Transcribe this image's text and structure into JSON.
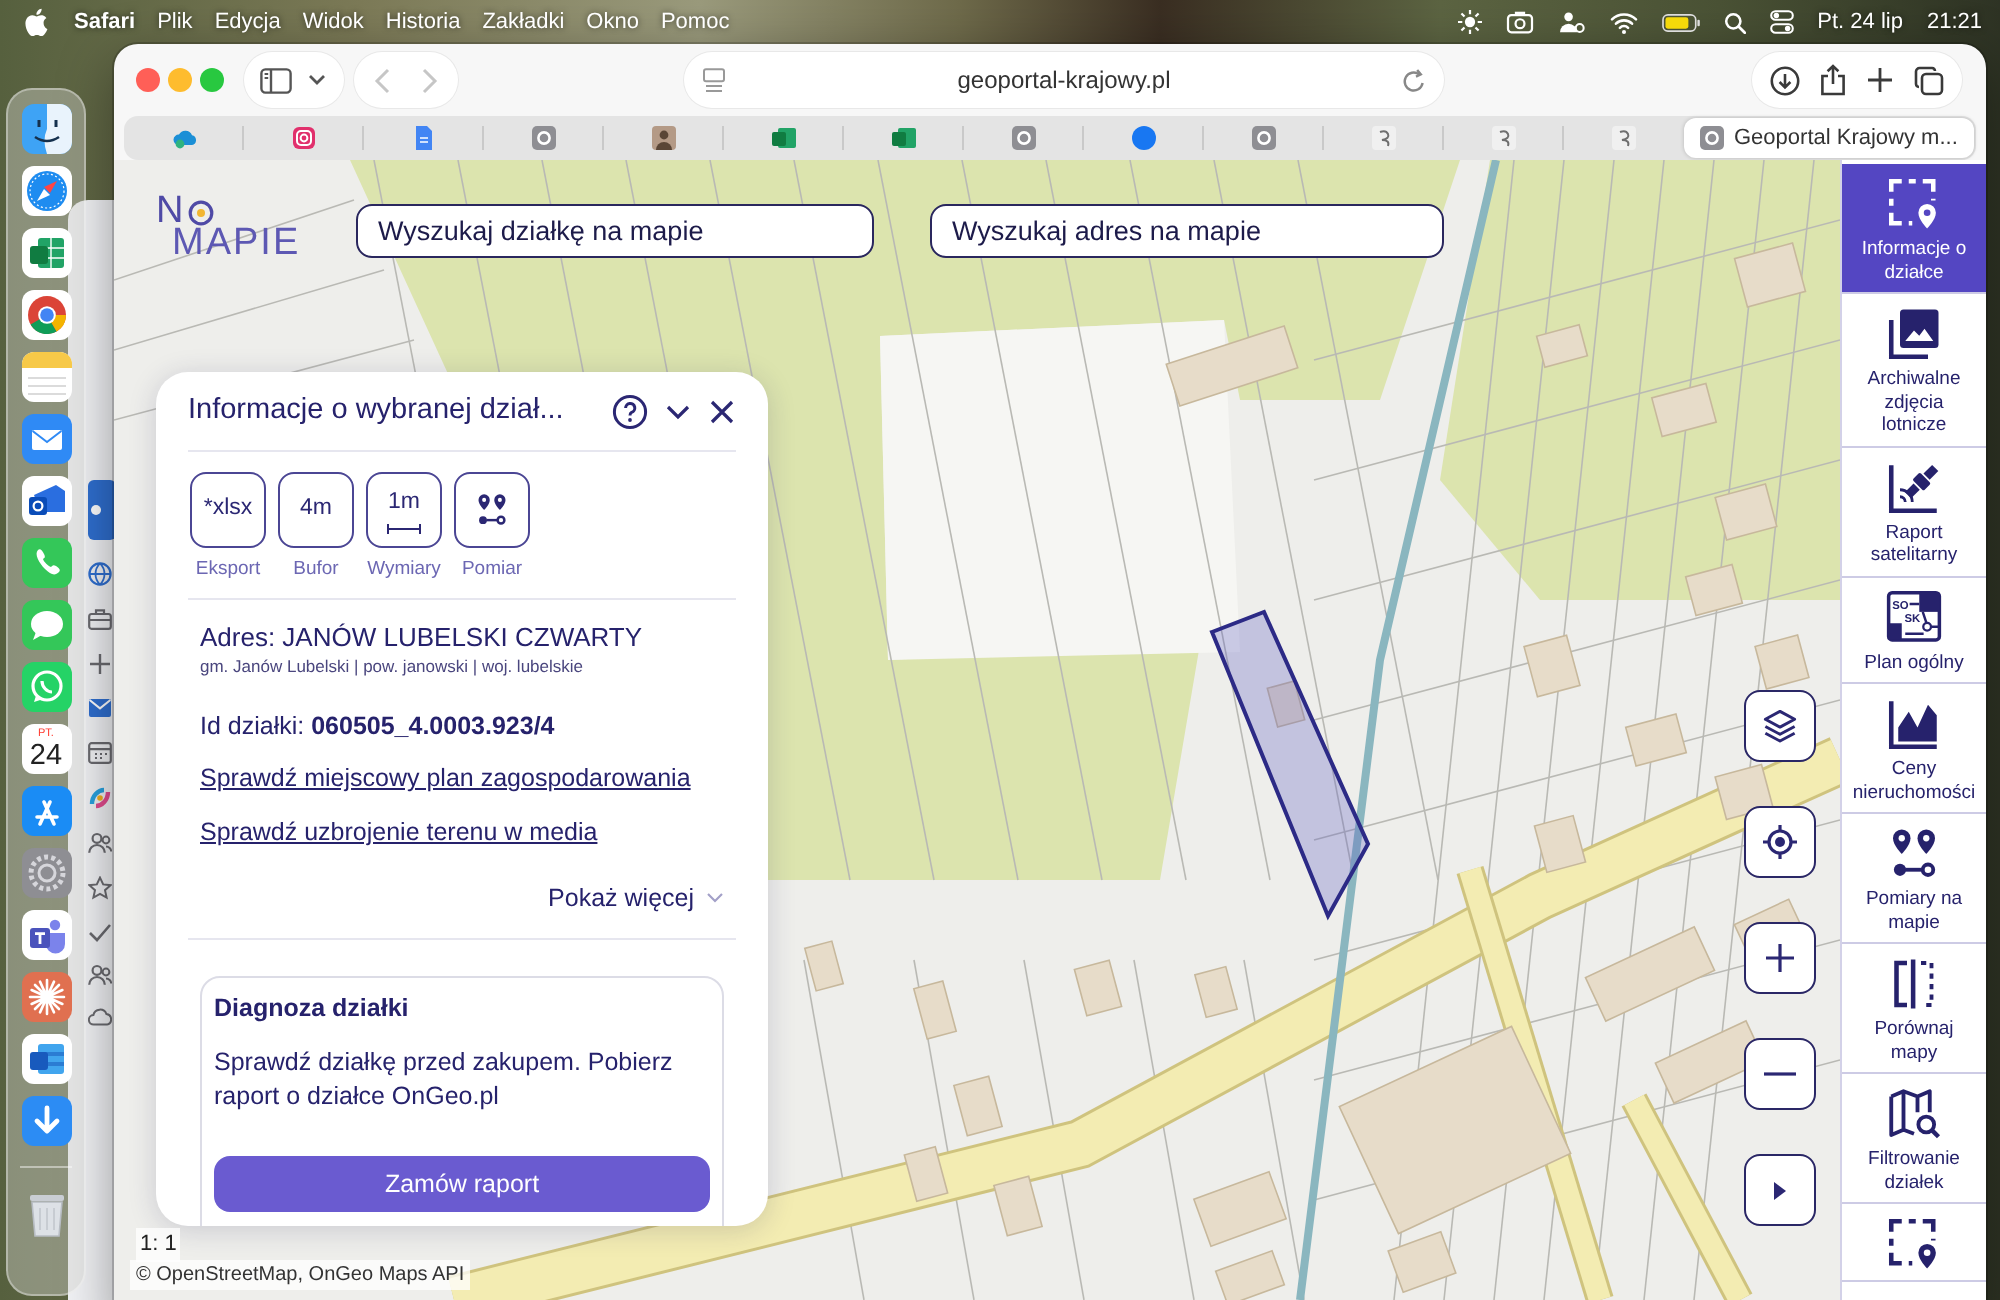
{
  "menu_bar": {
    "app": "Safari",
    "menus": [
      "Plik",
      "Edycja",
      "Widok",
      "Historia",
      "Zakładki",
      "Okno",
      "Pomoc"
    ],
    "status_icons": [
      {
        "kind": "sun"
      },
      {
        "kind": "camera"
      },
      {
        "kind": "person"
      },
      {
        "kind": "wifi"
      },
      {
        "kind": "battery"
      },
      {
        "kind": "search"
      },
      {
        "kind": "toggles"
      }
    ],
    "date": "Pt. 24 lip",
    "time": "21:21"
  },
  "dock": {
    "items": [
      {
        "kind": "finder"
      },
      {
        "kind": "compass"
      },
      {
        "kind": "spreadsheet"
      },
      {
        "kind": "wheel"
      },
      {
        "kind": "notes"
      },
      {
        "kind": "mail"
      },
      {
        "kind": "mailbox"
      },
      {
        "kind": "phone"
      },
      {
        "kind": "bubble"
      },
      {
        "kind": "chat"
      },
      {
        "kind": "calendar",
        "weekday": "PT.",
        "day": "24"
      },
      {
        "kind": "apps"
      },
      {
        "kind": "gear"
      },
      {
        "kind": "people"
      },
      {
        "kind": "sunburst"
      },
      {
        "kind": "document"
      },
      {
        "kind": "download"
      },
      {
        "kind": "separator"
      },
      {
        "kind": "trash"
      }
    ]
  },
  "background_window": {
    "icons": [
      {
        "kind": "tile"
      },
      {
        "kind": "globe"
      },
      {
        "kind": "briefcase"
      },
      {
        "kind": "plus"
      },
      {
        "kind": "envelope"
      },
      {
        "kind": "calendar"
      },
      {
        "kind": "swirl"
      },
      {
        "kind": "people"
      },
      {
        "kind": "star"
      },
      {
        "kind": "check"
      },
      {
        "kind": "people"
      },
      {
        "kind": "cloud"
      }
    ]
  },
  "browser": {
    "navigation": {
      "back_disabled": true,
      "forward_disabled": true
    },
    "address": "geoportal-krajowy.pl",
    "tabs": [
      {
        "kind": "cloud",
        "selected": false
      },
      {
        "kind": "camera",
        "selected": false
      },
      {
        "kind": "document",
        "selected": false
      },
      {
        "kind": "tile",
        "selected": false
      },
      {
        "kind": "avatar",
        "selected": false
      },
      {
        "kind": "spreadsheet",
        "selected": false
      },
      {
        "kind": "spreadsheet",
        "selected": false
      },
      {
        "kind": "tile",
        "selected": false
      },
      {
        "kind": "circle",
        "selected": false
      },
      {
        "kind": "tile",
        "selected": false
      },
      {
        "kind": "squiggle",
        "selected": false
      },
      {
        "kind": "squiggle",
        "selected": false
      },
      {
        "kind": "squiggle",
        "selected": false
      },
      {
        "kind": "tile",
        "selected": true,
        "title": "Geoportal Krajowy m..."
      }
    ]
  },
  "page": {
    "logo": {
      "top": "N",
      "bottom": "MAPIE"
    },
    "search_fields": [
      {
        "placeholder": "Wyszukaj działkę na mapie"
      },
      {
        "placeholder": "Wyszukaj adres na mapie"
      }
    ],
    "info_panel": {
      "title": "Informacje o wybranej dział...",
      "tools": [
        {
          "kind": "text",
          "face": "*xlsx",
          "label": "Eksport"
        },
        {
          "kind": "text",
          "face": "4m",
          "label": "Bufor"
        },
        {
          "kind": "ruler",
          "face": "1m",
          "label": "Wymiary"
        },
        {
          "kind": "pins",
          "label": "Pomiar"
        }
      ],
      "address": "Adres: JANÓW LUBELSKI CZWARTY",
      "admin_units": "gm. Janów Lubelski | pow. janowski | woj. lubelskie",
      "parcel_id": "Id działki: **060505_4.0003.923/4**",
      "links": [
        "Sprawdź miejscowy plan zagospodarowania",
        "Sprawdź uzbrojenie terenu w media"
      ],
      "more": "Pokaż więcej",
      "diagnosis": {
        "title": "Diagnoza działki",
        "text": "Sprawdź działkę przed zakupem. Pobierz raport o działce OnGeo.pl",
        "button": "Zamów raport"
      }
    },
    "map_controls": [
      {
        "kind": "layers"
      },
      {
        "kind": "locate"
      },
      {
        "kind": "zoom-in"
      },
      {
        "kind": "zoom-out"
      },
      {
        "kind": "play"
      }
    ],
    "sidebar": {
      "items": [
        {
          "kind": "parcel-info",
          "label": "Informacje o działce",
          "selected": true
        },
        {
          "kind": "aerial-photos",
          "label": "Archiwalne zdjęcia lotnicze",
          "selected": false
        },
        {
          "kind": "satellite",
          "label": "Raport satelitarny",
          "selected": false
        },
        {
          "kind": "zoning-plan",
          "label": "Plan ogólny",
          "icon_texts": [
            "SO",
            "SK"
          ],
          "selected": false
        },
        {
          "kind": "prices",
          "label": "Ceny nieruchomości",
          "selected": false
        },
        {
          "kind": "measure",
          "label": "Pomiary na mapie",
          "selected": false
        },
        {
          "kind": "compare",
          "label": "Porównaj mapy",
          "selected": false
        },
        {
          "kind": "filter",
          "label": "Filtrowanie działek",
          "selected": false
        },
        {
          "kind": "parcel-info",
          "selected": false
        }
      ]
    },
    "scale": "1: 1",
    "attribution": "© OpenStreetMap, OnGeo Maps API"
  }
}
